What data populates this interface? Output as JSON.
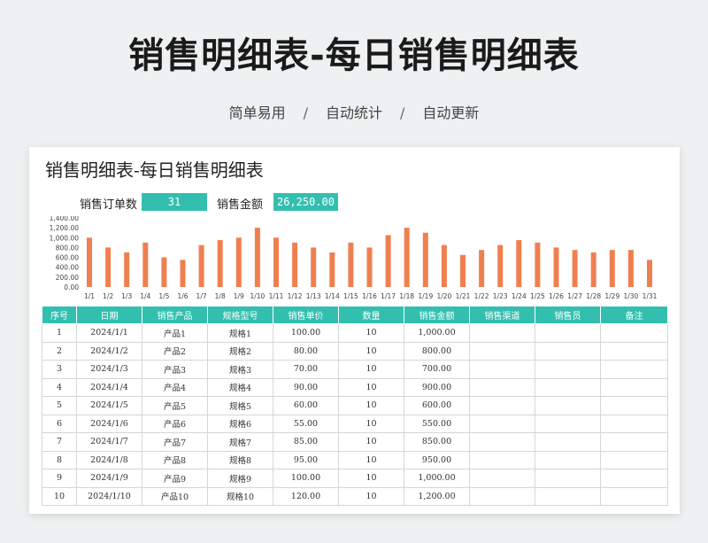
{
  "hero": {
    "title": "销售明细表-每日销售明细表",
    "tags": [
      "简单易用",
      "自动统计",
      "自动更新"
    ],
    "separator": "/"
  },
  "sheet": {
    "title": "销售明细表-每日销售明细表",
    "kpis": [
      {
        "label": "销售订单数",
        "value": "31"
      },
      {
        "label": "销售金额",
        "value": "26,250.00"
      }
    ]
  },
  "chart_data": {
    "type": "bar",
    "categories": [
      "1/1",
      "1/2",
      "1/3",
      "1/4",
      "1/5",
      "1/6",
      "1/7",
      "1/8",
      "1/9",
      "1/10",
      "1/11",
      "1/12",
      "1/13",
      "1/14",
      "1/15",
      "1/16",
      "1/17",
      "1/18",
      "1/19",
      "1/20",
      "1/21",
      "1/22",
      "1/23",
      "1/24",
      "1/25",
      "1/26",
      "1/27",
      "1/28",
      "1/29",
      "1/30",
      "1/31"
    ],
    "values": [
      1000,
      800,
      700,
      900,
      600,
      550,
      850,
      950,
      1000,
      1200,
      1000,
      900,
      800,
      700,
      900,
      800,
      1050,
      1200,
      1100,
      850,
      650,
      750,
      850,
      950,
      900,
      800,
      750,
      700,
      750,
      750,
      550
    ],
    "yticks": [
      "0.00",
      "200.00",
      "400.00",
      "600.00",
      "800.00",
      "1,000.00",
      "1,200.00",
      "1,400.00"
    ],
    "ylim": [
      0,
      1400
    ],
    "bar_color": "#f07f4f"
  },
  "table": {
    "headers": [
      "序号",
      "日期",
      "销售产品",
      "规格型号",
      "销售单价",
      "数量",
      "销售金额",
      "销售渠道",
      "销售员",
      "备注"
    ],
    "rows": [
      [
        "1",
        "2024/1/1",
        "产品1",
        "规格1",
        "100.00",
        "10",
        "1,000.00",
        "",
        "",
        ""
      ],
      [
        "2",
        "2024/1/2",
        "产品2",
        "规格2",
        "80.00",
        "10",
        "800.00",
        "",
        "",
        ""
      ],
      [
        "3",
        "2024/1/3",
        "产品3",
        "规格3",
        "70.00",
        "10",
        "700.00",
        "",
        "",
        ""
      ],
      [
        "4",
        "2024/1/4",
        "产品4",
        "规格4",
        "90.00",
        "10",
        "900.00",
        "",
        "",
        ""
      ],
      [
        "5",
        "2024/1/5",
        "产品5",
        "规格5",
        "60.00",
        "10",
        "600.00",
        "",
        "",
        ""
      ],
      [
        "6",
        "2024/1/6",
        "产品6",
        "规格6",
        "55.00",
        "10",
        "550.00",
        "",
        "",
        ""
      ],
      [
        "7",
        "2024/1/7",
        "产品7",
        "规格7",
        "85.00",
        "10",
        "850.00",
        "",
        "",
        ""
      ],
      [
        "8",
        "2024/1/8",
        "产品8",
        "规格8",
        "95.00",
        "10",
        "950.00",
        "",
        "",
        ""
      ],
      [
        "9",
        "2024/1/9",
        "产品9",
        "规格9",
        "100.00",
        "10",
        "1,000.00",
        "",
        "",
        ""
      ],
      [
        "10",
        "2024/1/10",
        "产品10",
        "规格10",
        "120.00",
        "10",
        "1,200.00",
        "",
        "",
        ""
      ]
    ],
    "header_color": "#33bfb0"
  }
}
